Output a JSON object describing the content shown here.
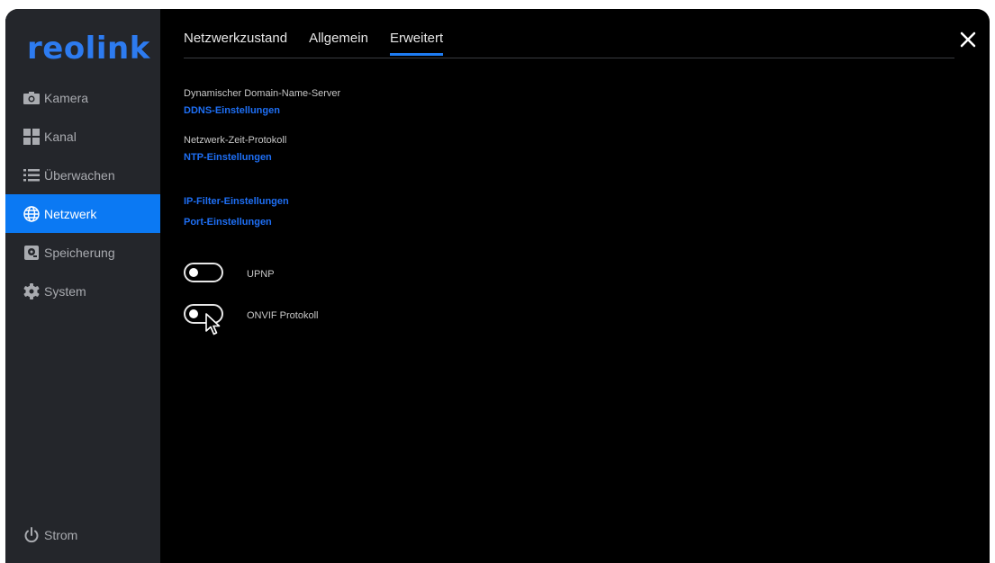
{
  "app": {
    "logo_text": "reolink",
    "brand_color": "#0b79f3"
  },
  "sidebar": {
    "items": [
      {
        "label": "Kamera",
        "icon": "camera-icon"
      },
      {
        "label": "Kanal",
        "icon": "grid-icon"
      },
      {
        "label": "Überwachen",
        "icon": "list-icon"
      },
      {
        "label": "Netzwerk",
        "icon": "globe-icon",
        "active": true
      },
      {
        "label": "Speicherung",
        "icon": "storage-icon"
      },
      {
        "label": "System",
        "icon": "gear-icon"
      }
    ],
    "power": {
      "label": "Strom",
      "icon": "power-icon"
    }
  },
  "tabs": [
    {
      "label": "Netzwerkzustand"
    },
    {
      "label": "Allgemein"
    },
    {
      "label": "Erweitert",
      "active": true
    }
  ],
  "settings": {
    "ddns_label": "Dynamischer Domain-Name-Server",
    "ddns_link": "DDNS-Einstellungen",
    "ntp_label": "Netzwerk-Zeit-Protokoll",
    "ntp_link": "NTP-Einstellungen",
    "ip_filter_link": "IP-Filter-Einstellungen",
    "port_link": "Port-Einstellungen",
    "toggles": [
      {
        "label": "UPNP",
        "on": false
      },
      {
        "label": "ONVIF Protokoll",
        "on": false
      }
    ]
  }
}
